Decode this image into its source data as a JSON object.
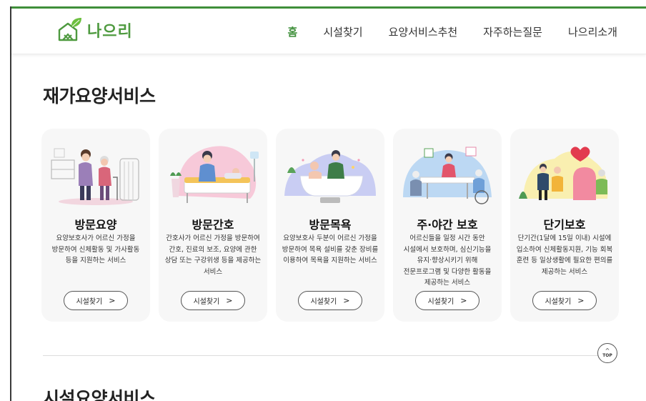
{
  "brand": {
    "name": "나으리",
    "color": "#4e9a3f"
  },
  "nav": [
    {
      "label": "홈",
      "active": true
    },
    {
      "label": "시설찾기",
      "active": false
    },
    {
      "label": "요양서비스추천",
      "active": false
    },
    {
      "label": "자주하는질문",
      "active": false
    },
    {
      "label": "나으리소개",
      "active": false
    }
  ],
  "section1": {
    "title": "재가요양서비스"
  },
  "cards": [
    {
      "title": "방문요양",
      "desc": "요양보호사가 어르신 가정을 방문하여 신체활동 및 가사활동 등을 지원하는 서비스",
      "button": "시설찾기",
      "icon": "home-care-illustration"
    },
    {
      "title": "방문간호",
      "desc": "간호사가 어르신 가정을 방문하여 간호, 진료의 보조, 요양에 관한 상담 또는 구강위생 등을 제공하는 서비스",
      "button": "시설찾기",
      "icon": "home-nursing-illustration"
    },
    {
      "title": "방문목욕",
      "desc": "요양보호사 두분이 어르신 가정을 방문하여 목욕 설비를 갖춘 장비를 이용하여 목욕을 지원하는 서비스",
      "button": "시설찾기",
      "icon": "home-bathing-illustration"
    },
    {
      "title": "주·야간 보호",
      "desc": "어르신들을 일정 시간 동안 시설에서 보호하며, 심신기능을 유지·향상시키기 위해 전문프로그램 및 다양한 활동을 제공하는 서비스",
      "button": "시설찾기",
      "icon": "day-night-care-illustration"
    },
    {
      "title": "단기보호",
      "desc": "단기간(1달에 15일 이내) 시설에 입소하여 신체활동지원, 기능 회복 훈련 등 일상생활에 필요한 편의를 제공하는 서비스",
      "button": "시설찾기",
      "icon": "short-term-care-illustration"
    }
  ],
  "top_button": {
    "label": "TOP",
    "arrow": "^"
  },
  "section2": {
    "title": "시설요양서비스"
  }
}
